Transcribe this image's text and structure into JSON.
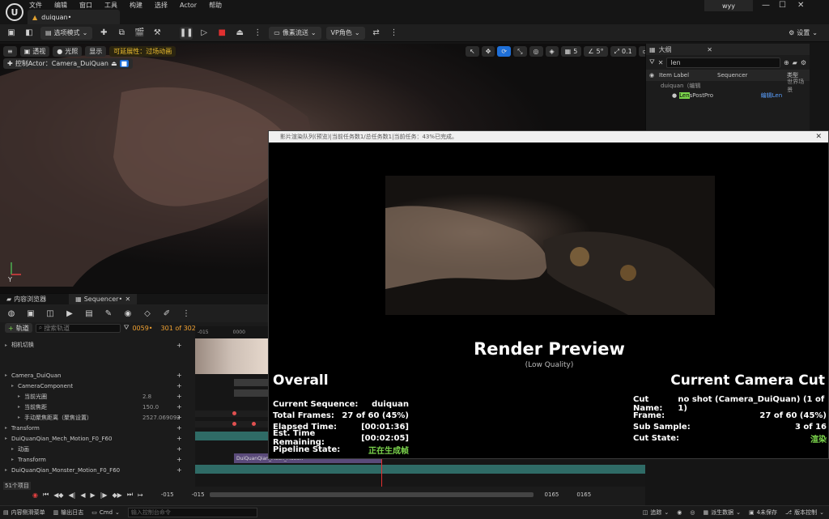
{
  "app": {
    "doc_tab": "duiquan•",
    "user": "wyy"
  },
  "menu": [
    "文件",
    "编辑",
    "窗口",
    "工具",
    "构建",
    "选择",
    "Actor",
    "帮助"
  ],
  "toolbar": {
    "select_mode": "选项模式",
    "pixel_stream": "像素流送",
    "vp_role": "VP角色",
    "settings": "设置"
  },
  "viewport": {
    "perspective": "透视",
    "lit": "光照",
    "show": "显示",
    "note": "可延展性：过场动画",
    "pilot": "控制Actor：Camera_DuiQuan",
    "grid_val": "5",
    "angle_val": "5°",
    "scale_val": "0.1",
    "cam_speed": "1",
    "axis_y": "Y"
  },
  "outliner": {
    "title": "大纲",
    "search": "len",
    "col_label": "Item Label",
    "col_seq": "Sequencer",
    "col_type": "类型",
    "rows": [
      {
        "label": "duiquan（编辑",
        "type": "世界场景"
      },
      {
        "label_hl": "Len",
        "label_rest": "sPostPro",
        "type": "编辑Len"
      }
    ]
  },
  "content_tabs": {
    "browser": "内容浏览器",
    "sequencer": "Sequencer•"
  },
  "sequencer": {
    "add_track": "轨道",
    "search_placeholder": "搜索轨道",
    "frame_current": "0059•",
    "frame_range": "301 of 302",
    "ruler_start": "-015",
    "ruler_mark": "0000",
    "tracks": [
      {
        "name": "相机切换",
        "indent": 0
      },
      {
        "name": "Camera_DuiQuan",
        "indent": 0
      },
      {
        "name": "CameraComponent",
        "indent": 1
      },
      {
        "name": "当前光圈",
        "indent": 2,
        "value": "2.8"
      },
      {
        "name": "当前焦距",
        "indent": 2,
        "value": "150.0"
      },
      {
        "name": "手动聚焦距离（聚焦设置）",
        "indent": 2,
        "value": "2527.069092"
      },
      {
        "name": "Transform",
        "indent": 0
      },
      {
        "name": "DuiQuanQian_Mech_Motion_F0_F60",
        "indent": 0
      },
      {
        "name": "动画",
        "indent": 1
      },
      {
        "name": "Transform",
        "indent": 1
      },
      {
        "name": "DuiQuanQian_Monster_Motion_F0_F60",
        "indent": 0
      }
    ],
    "clip_label": "DuiQuanQian_Mech_Motion",
    "item_count": "51个项目",
    "bottom_left_a": "-015",
    "bottom_left_b": "-015",
    "bottom_right_a": "0165",
    "bottom_right_b": "0165"
  },
  "status": {
    "drawer": "内容侧滑菜单",
    "log": "输出日志",
    "cmd": "Cmd",
    "cmd_placeholder": "输入控制台命令",
    "trace": "追踪",
    "derived": "派生数据",
    "unsaved": "4未保存",
    "vcs": "版本控制"
  },
  "render": {
    "window_title": "影片渲染队列(预览)|当前任务数1/总任务数1|当前任务：43%已完成。",
    "heading": "Render Preview",
    "subheading": "(Low Quality)",
    "overall_title": "Overall",
    "overall": [
      {
        "k": "Current Sequence:",
        "v": "duiquan"
      },
      {
        "k": "Total Frames:",
        "v": "27 of 60 (45%)"
      },
      {
        "k": "Elapsed Time:",
        "v": "[00:01:36]"
      },
      {
        "k": "Est. Time Remaining:",
        "v": "[00:02:05]"
      },
      {
        "k": "Pipeline State:",
        "v": "正在生成帧"
      }
    ],
    "cut_title": "Current Camera Cut",
    "cut": [
      {
        "k": "Cut Name:",
        "v": "no shot (Camera_DuiQuan) (1 of 1)"
      },
      {
        "k": "Frame:",
        "v": "27 of 60 (45%)"
      },
      {
        "k": "Sub Sample:",
        "v": "3 of 16"
      },
      {
        "k": "Cut State:",
        "v": "渲染"
      }
    ]
  },
  "colors": {
    "accent_green": "#7bd44c",
    "note_yellow": "#f0c030",
    "clip_teal": "#2f6b66",
    "clip_purple": "#5a4a7a",
    "select_blue": "#1e6fd8"
  }
}
